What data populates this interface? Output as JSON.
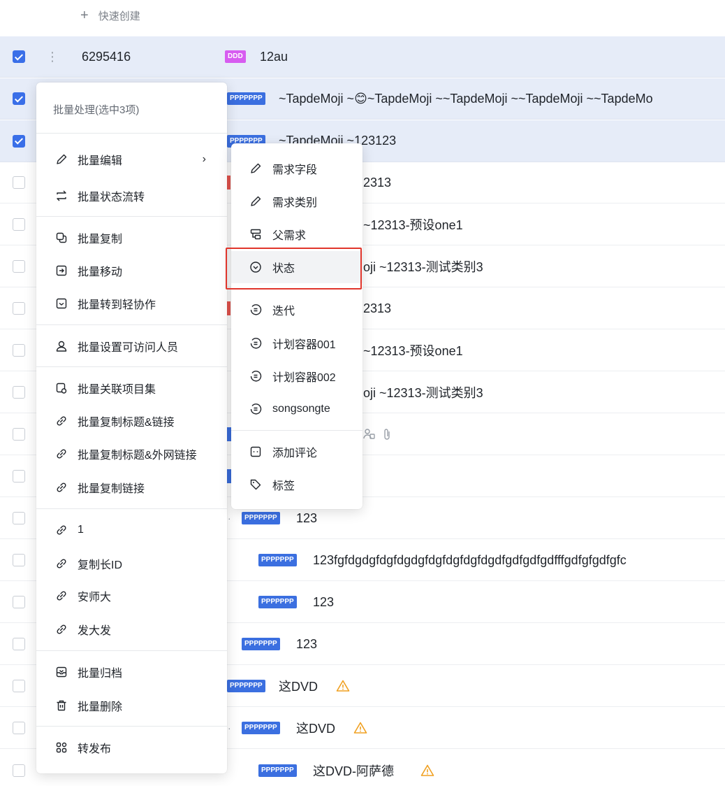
{
  "quick_create": {
    "label": "快速创建"
  },
  "rows": [
    {
      "id": "6295416",
      "tag": "DDD",
      "title": "12au",
      "checked": true
    },
    {
      "id": "",
      "tag": "PPPPPPP",
      "title": "~TapdeMoji ~😊~TapdeMoji ~~TapdeMoji ~~TapdeMoji ~~TapdeMo",
      "checked": true
    },
    {
      "id": "",
      "tag": "PPPPPPP",
      "title": "~TapdeMoji ~123123",
      "checked": true
    },
    {
      "id": "",
      "tag": "",
      "title": "2313",
      "checked": false
    },
    {
      "id": "",
      "tag": "",
      "title": "~12313-预设one1",
      "checked": false
    },
    {
      "id": "",
      "tag": "",
      "title": "oji ~12313-测试类别3",
      "checked": false
    },
    {
      "id": "",
      "tag": "",
      "title": "2313",
      "checked": false
    },
    {
      "id": "",
      "tag": "",
      "title": "~12313-预设one1",
      "checked": false
    },
    {
      "id": "",
      "tag": "",
      "title": "oji ~12313-测试类别3",
      "checked": false
    },
    {
      "id": "",
      "tag": "",
      "title": "",
      "checked": false
    },
    {
      "id": "",
      "tag": "",
      "title": "",
      "checked": false
    },
    {
      "id": "",
      "tag": "PPPPPPP",
      "title": "123",
      "checked": false
    },
    {
      "id": "",
      "tag": "PPPPPPP",
      "title": "123fgfdgdgfdgfdgdgfdgfdgfdgfdgdfgdfgdfgdfffgdfgfgdfgfc",
      "checked": false
    },
    {
      "id": "",
      "tag": "PPPPPPP",
      "title": "123",
      "checked": false
    },
    {
      "id": "",
      "tag": "PPPPPPP",
      "title": "123",
      "checked": false
    },
    {
      "id": "",
      "tag": "PPPPPPP",
      "title": "这DVD",
      "checked": false
    },
    {
      "id": "",
      "tag": "PPPPPPP",
      "title": "这DVD",
      "checked": false
    },
    {
      "id": "",
      "tag": "PPPPPPP",
      "title": "这DVD-阿萨德",
      "checked": false
    }
  ],
  "batch_menu": {
    "header": "批量处理(选中3项)",
    "items": [
      {
        "label": "批量编辑",
        "icon": "pencil-icon"
      },
      {
        "label": "批量状态流转",
        "icon": "swap-icon"
      },
      {
        "label": "批量复制",
        "icon": "copy-icon"
      },
      {
        "label": "批量移动",
        "icon": "move-icon"
      },
      {
        "label": "批量转到轻协作",
        "icon": "convert-icon"
      },
      {
        "label": "批量设置可访问人员",
        "icon": "user-icon"
      },
      {
        "label": "批量关联项目集",
        "icon": "project-set-icon"
      },
      {
        "label": "批量复制标题&链接",
        "icon": "link-icon"
      },
      {
        "label": "批量复制标题&外网链接",
        "icon": "link-icon"
      },
      {
        "label": "批量复制链接",
        "icon": "link-icon"
      },
      {
        "label": "1",
        "icon": "link-icon"
      },
      {
        "label": "复制长ID",
        "icon": "link-icon"
      },
      {
        "label": "安师大",
        "icon": "link-icon"
      },
      {
        "label": "发大发",
        "icon": "link-icon"
      },
      {
        "label": "批量归档",
        "icon": "archive-icon"
      },
      {
        "label": "批量删除",
        "icon": "trash-icon"
      },
      {
        "label": "转发布",
        "icon": "grid-icon"
      }
    ]
  },
  "sub_menu": {
    "items": [
      {
        "label": "需求字段",
        "icon": "pencil-icon"
      },
      {
        "label": "需求类别",
        "icon": "pencil-icon"
      },
      {
        "label": "父需求",
        "icon": "hierarchy-icon"
      },
      {
        "label": "状态",
        "icon": "status-circle-icon"
      },
      {
        "label": "迭代",
        "icon": "iteration-icon"
      },
      {
        "label": "计划容器001",
        "icon": "iteration-icon"
      },
      {
        "label": "计划容器002",
        "icon": "iteration-icon"
      },
      {
        "label": "songsongte",
        "icon": "iteration-icon"
      },
      {
        "label": "添加评论",
        "icon": "comment-icon"
      },
      {
        "label": "标签",
        "icon": "tag-icon"
      }
    ]
  },
  "colors": {
    "accent": "#3a6fe8",
    "highlight_box": "#e0352b",
    "warning": "#f0a020"
  }
}
